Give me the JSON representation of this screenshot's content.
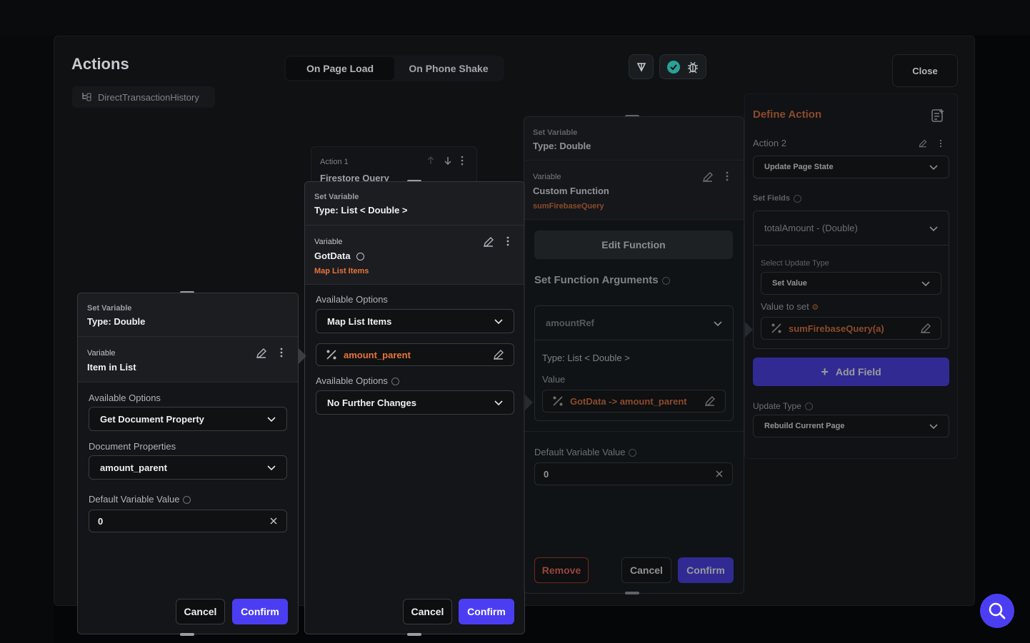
{
  "header": {
    "title": "Actions",
    "page_name": "DirectTransactionHistory",
    "tabs": [
      {
        "label": "On Page Load",
        "active": true
      },
      {
        "label": "On Phone Shake",
        "active": false
      }
    ],
    "close_label": "Close",
    "icons": [
      "debug-icon",
      "check-circle-icon",
      "bug-icon"
    ]
  },
  "bg_action": {
    "label": "Action 1",
    "title": "Firestore Query"
  },
  "panel1": {
    "kind": "Set Variable",
    "type": "Type: Double",
    "var_label": "Variable",
    "var_name": "Item in List",
    "available_label": "Available Options",
    "available_value": "Get Document Property",
    "doc_props_label": "Document Properties",
    "doc_props_value": "amount_parent",
    "default_label": "Default Variable Value",
    "default_value": "0",
    "cancel": "Cancel",
    "confirm": "Confirm"
  },
  "panel2": {
    "kind": "Set Variable",
    "type": "Type: List < Double >",
    "var_label": "Variable",
    "var_name": "GotData",
    "var_sub": "Map List Items",
    "available_label": "Available Options",
    "available_value": "Map List Items",
    "mapped_value": "amount_parent",
    "available2_label": "Available Options",
    "available2_value": "No Further Changes",
    "cancel": "Cancel",
    "confirm": "Confirm"
  },
  "panel3": {
    "kind": "Set Variable",
    "type": "Type: Double",
    "var_label": "Variable",
    "var_name": "Custom Function",
    "var_sub": "sumFirebaseQuery",
    "edit_function": "Edit Function",
    "args_label": "Set Function Arguments",
    "arg_name": "amountRef",
    "arg_type": "Type: List < Double >",
    "value_label": "Value",
    "value_text": "GotData -> amount_parent",
    "default_label": "Default Variable Value",
    "default_value": "0",
    "remove": "Remove",
    "cancel": "Cancel",
    "confirm": "Confirm"
  },
  "panel4": {
    "title": "Define Action",
    "action_label": "Action 2",
    "action_value": "Update Page State",
    "set_fields_label": "Set Fields",
    "field_value": "totalAmount - (Double)",
    "update_type_label": "Select Update Type",
    "update_type_value": "Set Value",
    "value_to_set_label": "Value to set",
    "value_to_set": "sumFirebaseQuery(a)",
    "add_field": "Add Field",
    "update_type2_label": "Update Type",
    "update_type2_value": "Rebuild Current Page"
  },
  "colors": {
    "accent": "#4b3ef2",
    "orange": "#e8743b",
    "teal": "#2aa198",
    "remove_red": "#c0392b"
  }
}
